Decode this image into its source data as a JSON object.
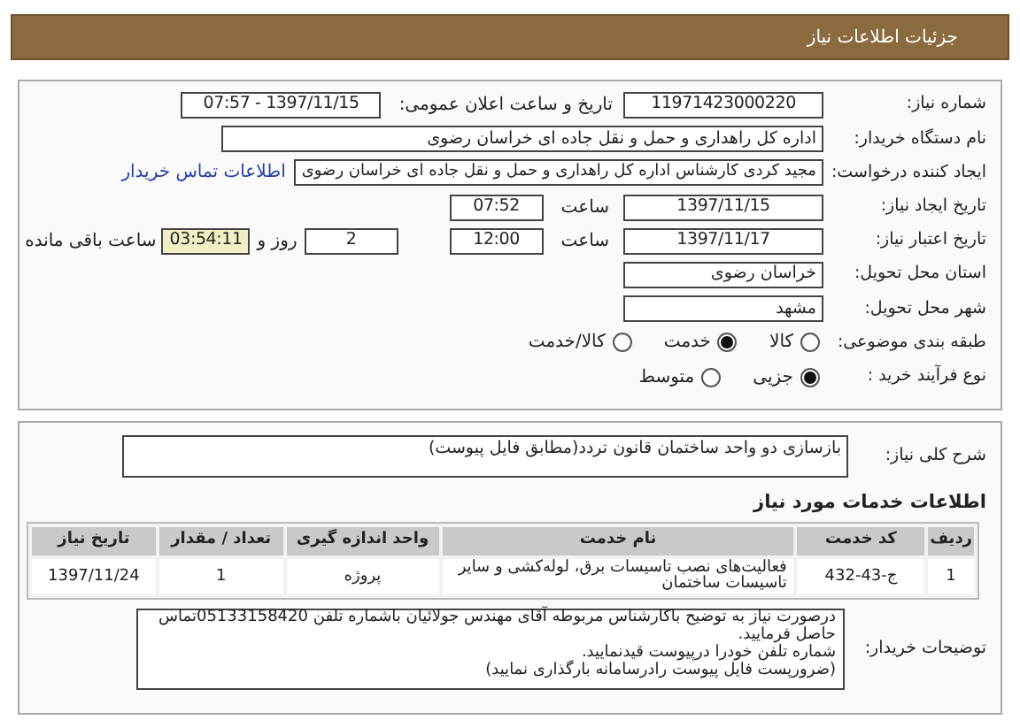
{
  "header": {
    "title": "جزئیات اطلاعات نیاز"
  },
  "fields": {
    "need_number": {
      "label": "شماره نیاز:",
      "value": "11971423000220"
    },
    "announce": {
      "label": "تاریخ و ساعت اعلان عمومی:",
      "value": "1397/11/15 - 07:57"
    },
    "buyer": {
      "label": "نام دستگاه خریدار:",
      "value": "اداره کل راهداری و حمل و نقل جاده ای خراسان رضوی"
    },
    "requester": {
      "label": "ایجاد کننده درخواست:",
      "value": "مجید کردی کارشناس اداره کل راهداری و حمل و نقل جاده ای خراسان رضوی",
      "link": "اطلاعات تماس خریدار"
    },
    "created": {
      "label": "تاریخ ایجاد نیاز:",
      "date": "1397/11/15",
      "time_label": "ساعت",
      "time": "07:52"
    },
    "validity": {
      "label": "تاریخ اعتبار نیاز:",
      "date": "1397/11/17",
      "time_label": "ساعت",
      "time": "12:00",
      "days": "2",
      "days_label": "روز و",
      "remaining": "03:54:11",
      "remaining_label": "ساعت باقی مانده"
    },
    "province": {
      "label": "استان محل تحویل:",
      "value": "خراسان رضوی"
    },
    "city": {
      "label": "شهر محل تحویل:",
      "value": "مشهد"
    }
  },
  "category": {
    "label": "طبقه بندی موضوعی:",
    "options": [
      {
        "label": "کالا",
        "selected": false
      },
      {
        "label": "خدمت",
        "selected": true
      },
      {
        "label": "کالا/خدمت",
        "selected": false
      }
    ]
  },
  "process": {
    "label": "نوع فرآیند خرید :",
    "options": [
      {
        "label": "جزیی",
        "selected": true
      },
      {
        "label": "متوسط",
        "selected": false
      }
    ]
  },
  "description": {
    "label": "شرح کلی نیاز:",
    "value": "بازسازی دو واحد ساختمان قانون تردد(مطابق فایل پیوست)"
  },
  "services": {
    "title": "اطلاعات خدمات مورد نیاز",
    "columns": [
      "ردیف",
      "کد خدمت",
      "نام خدمت",
      "واحد اندازه گیری",
      "تعداد / مقدار",
      "تاریخ نیاز"
    ],
    "rows": [
      [
        "1",
        "ج-43-432",
        "فعالیت‌های نصب تاسیسات برق، لوله‌کشی و سایر تاسیسات ساختمان",
        "پروژه",
        "1",
        "1397/11/24"
      ]
    ]
  },
  "notes": {
    "label": "توضیحات خریدار:",
    "lines": [
      "درصورت نیاز به توضیح باکارشناس مربوطه آقای مهندس جولائیان باشماره تلفن 05133158420تماس حاصل فرمایید.",
      "شماره تلفن خودرا درپیوست قیدنمایید.",
      "(ضرورپست فایل پیوست رادرسامانه بارگذاری نمایید)"
    ]
  }
}
